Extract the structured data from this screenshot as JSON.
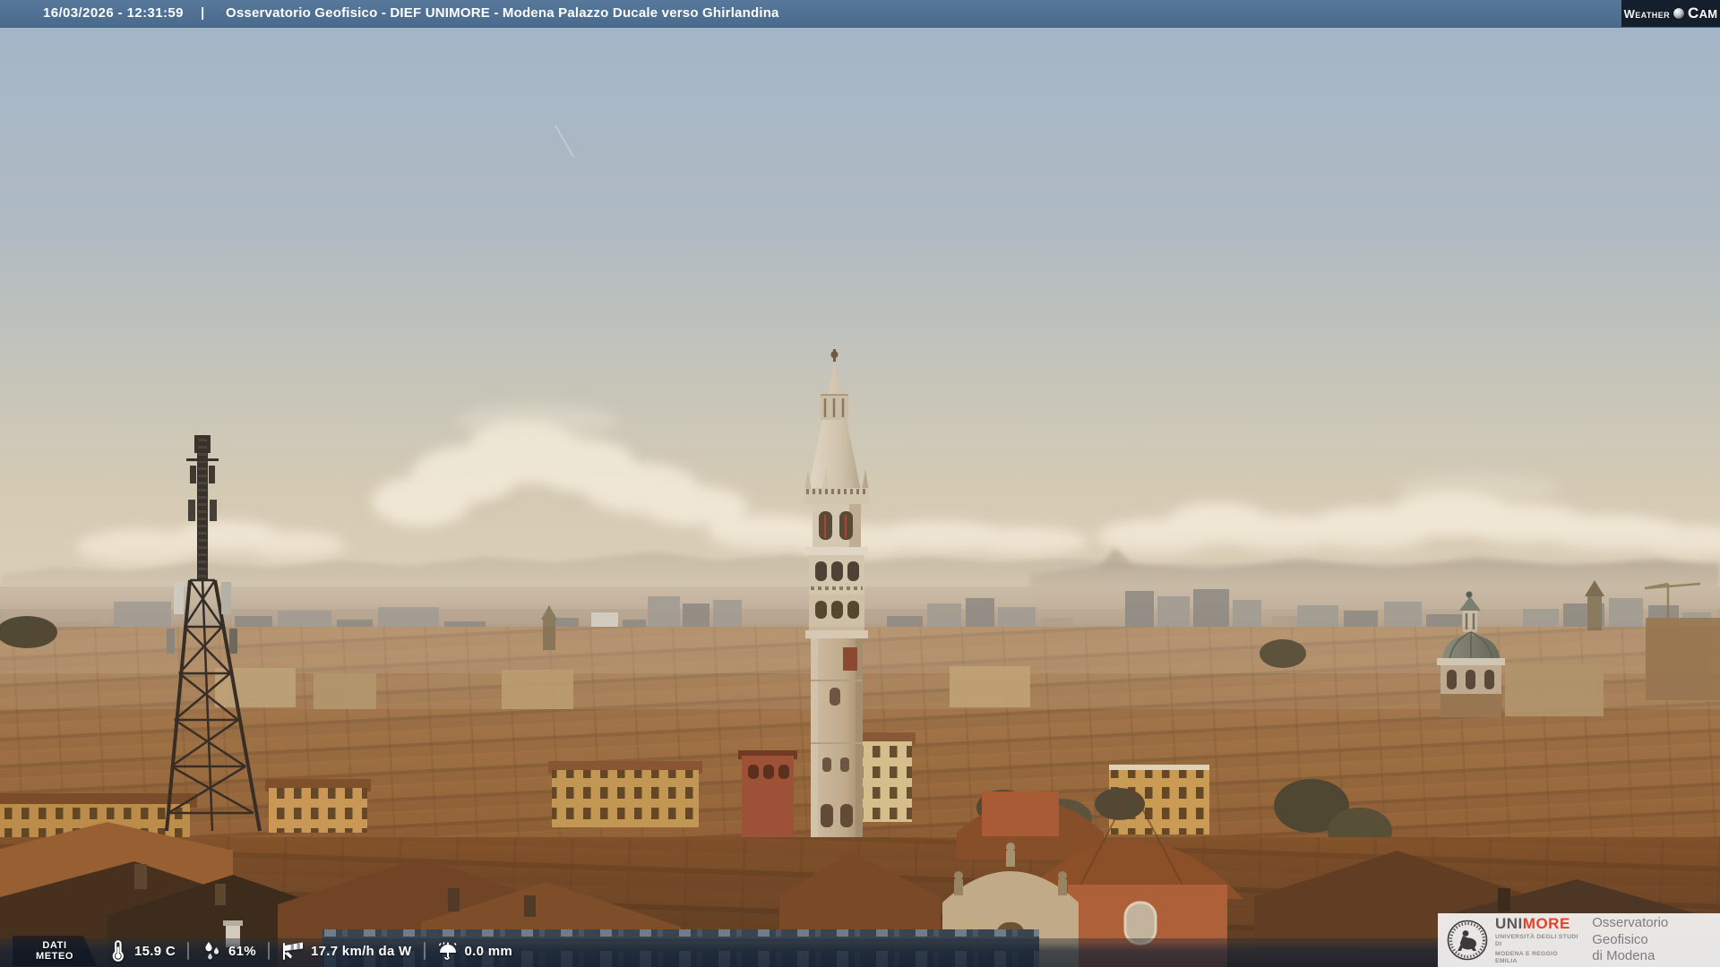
{
  "header": {
    "timestamp": "16/03/2026 - 12:31:59",
    "separator": "|",
    "title": "Osservatorio Geofisico - DIEF UNIMORE - Modena Palazzo Ducale verso Ghirlandina",
    "weathercam": {
      "word1": "Weather",
      "word2": "Cam",
      "icon": "weathercam-ball-icon"
    }
  },
  "scene": {
    "description": "Daytime panorama over Modena rooftops: lattice antenna tower at left, Ghirlandina tower at centre, San Biagio dome at right, hazy Apennines on the horizon",
    "landmarks": [
      "antenna-lattice-tower",
      "ghirlandina-tower",
      "san-biagio-dome"
    ]
  },
  "weather_bar": {
    "label": {
      "line1": "DATI",
      "line2": "METEO"
    },
    "items": [
      {
        "id": "temperature",
        "icon": "thermometer-icon",
        "value": "15.9 C"
      },
      {
        "id": "humidity",
        "icon": "humidity-drops-icon",
        "value": "61%"
      },
      {
        "id": "wind",
        "icon": "windsock-icon",
        "value": "17.7 km/h da W"
      },
      {
        "id": "rain",
        "icon": "umbrella-rain-icon",
        "value": "0.0 mm"
      }
    ]
  },
  "branding": {
    "seal_icon": "unimore-seal-icon",
    "wordmark": {
      "part1": "UNI",
      "part2": "MORE"
    },
    "university": {
      "line1": "UNIVERSITÀ DEGLI STUDI DI",
      "line2": "MODENA E REGGIO EMILIA"
    },
    "observatory": {
      "line1": "Osservatorio Geofisico",
      "line2": "di Modena"
    }
  },
  "colors": {
    "top_bar": "#4f7095",
    "logo_box": "#151f2b",
    "sky_top": "#a3b6c8",
    "horizon_haze": "#dbceb6",
    "roof_brown": "#8f6239",
    "scrim": "rgba(18,32,52,0.55)",
    "unimore_red": "#e2432b",
    "unimore_gray": "#59595b"
  }
}
